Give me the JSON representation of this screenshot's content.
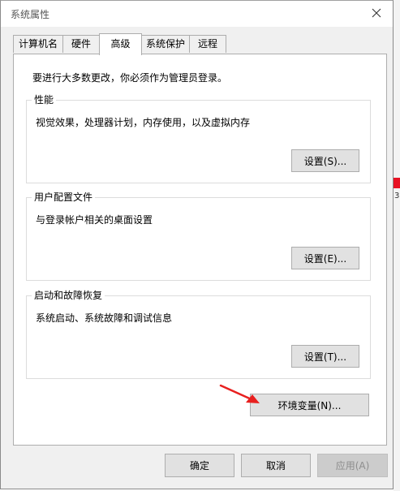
{
  "window": {
    "title": "系统属性"
  },
  "tabs": [
    {
      "label": "计算机名"
    },
    {
      "label": "硬件"
    },
    {
      "label": "高级"
    },
    {
      "label": "系统保护"
    },
    {
      "label": "远程"
    }
  ],
  "advanced": {
    "notice": "要进行大多数更改，你必须作为管理员登录。",
    "performance": {
      "title": "性能",
      "desc": "视觉效果，处理器计划，内存使用，以及虚拟内存",
      "button": "设置(S)..."
    },
    "user_profiles": {
      "title": "用户配置文件",
      "desc": "与登录帐户相关的桌面设置",
      "button": "设置(E)..."
    },
    "startup_recovery": {
      "title": "启动和故障恢复",
      "desc": "系统启动、系统故障和调试信息",
      "button": "设置(T)..."
    },
    "env_vars_button": "环境变量(N)..."
  },
  "footer": {
    "ok": "确定",
    "cancel": "取消",
    "apply": "应用(A)"
  },
  "background": {
    "edge_text": "3"
  },
  "colors": {
    "annotation_arrow": "#e8201f",
    "window_bg": "#f0f0f0",
    "panel_bg": "#ffffff"
  }
}
